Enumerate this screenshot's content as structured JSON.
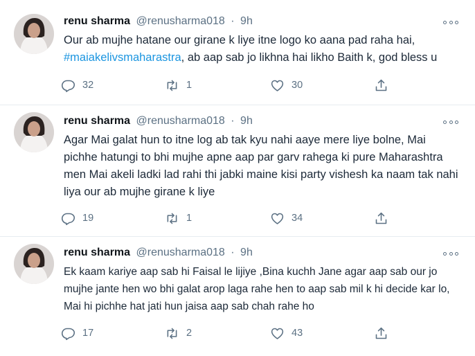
{
  "tweets": [
    {
      "name": "renu sharma",
      "handle": "@renusharma018",
      "sep": "·",
      "time": "9h",
      "text_before": "Our ab mujhe hatane our girane k liye itne logo ko aana pad raha hai,",
      "hashtag": "#maiakelivsmaharastra",
      "text_after": ", ab aap sab jo likhna hai likho Baith k, god bless u",
      "replies": "32",
      "retweets": "1",
      "likes": "30"
    },
    {
      "name": "renu sharma",
      "handle": "@renusharma018",
      "sep": "·",
      "time": "9h",
      "text": "Agar Mai galat hun to itne log ab tak kyu nahi aaye mere liye bolne, Mai pichhe hatungi to bhi mujhe apne aap par garv rahega ki pure Maharashtra men Mai akeli ladki lad rahi thi jabki maine kisi party vishesh ka naam tak nahi liya our ab mujhe girane k liye",
      "replies": "19",
      "retweets": "1",
      "likes": "34"
    },
    {
      "name": "renu sharma",
      "handle": "@renusharma018",
      "sep": "·",
      "time": "9h",
      "text": "Ek kaam kariye aap sab hi Faisal le lijiye ,Bina kuchh Jane agar aap sab our jo mujhe jante hen wo bhi galat arop laga rahe hen to aap sab mil k hi decide kar lo, Mai hi pichhe hat jati hun jaisa aap sab chah rahe ho",
      "replies": "17",
      "retweets": "2",
      "likes": "43"
    }
  ],
  "icons": {
    "reply": "reply-icon",
    "retweet": "retweet-icon",
    "like": "heart-icon",
    "share": "share-icon",
    "more": "more-options-icon"
  },
  "colors": {
    "text": "#1c2938",
    "secondary": "#5b7083",
    "hashtag": "#1b95e0",
    "divider": "#e6ecf0"
  }
}
